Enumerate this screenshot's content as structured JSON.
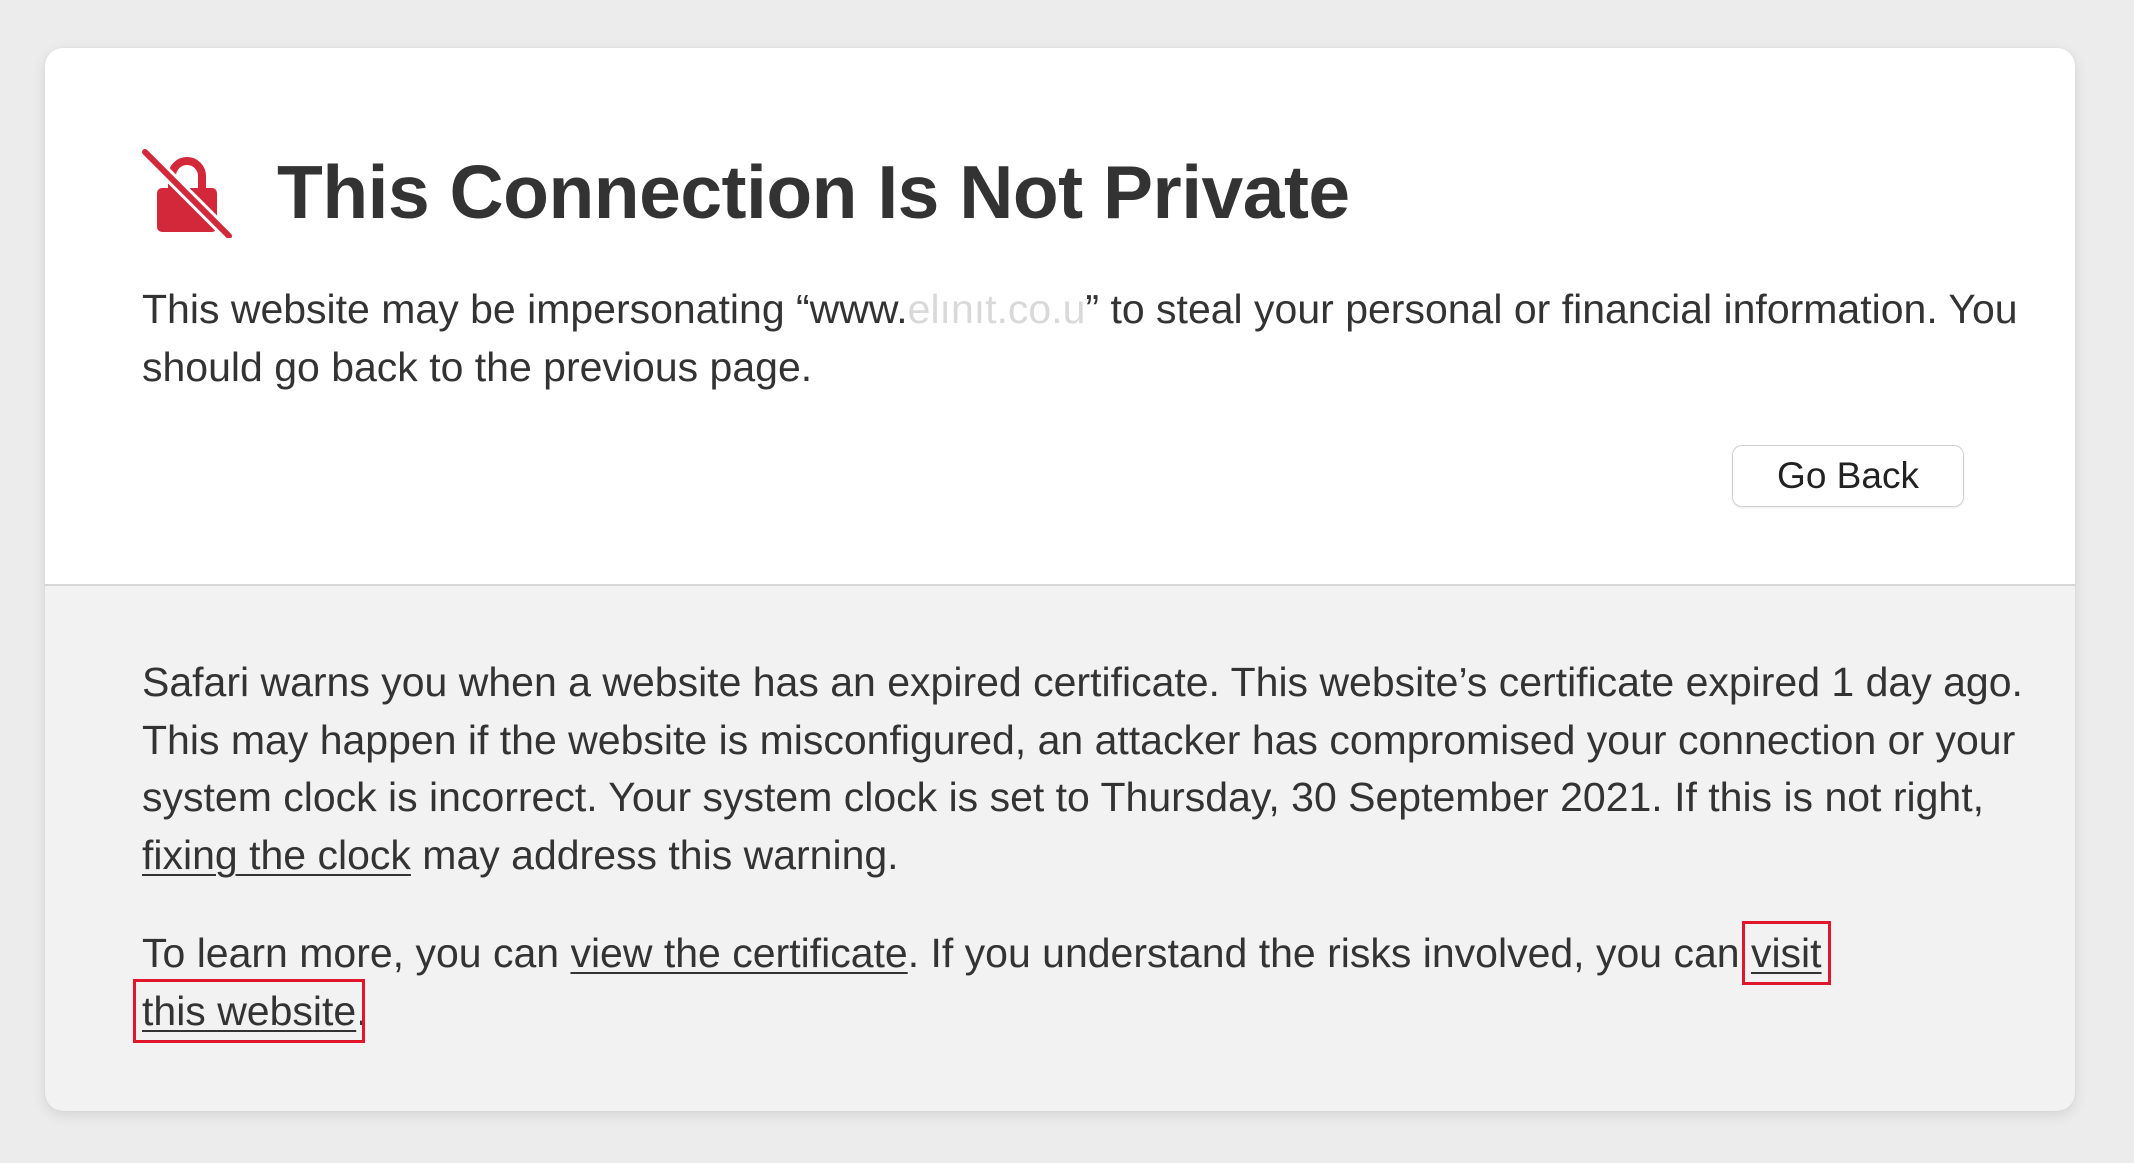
{
  "window": {
    "title": "This Connection Is Not Private"
  },
  "icons": {
    "warning": "broken-lock-icon",
    "warning_color": "#d3283a"
  },
  "warning": {
    "line_start": "This website may be impersonating “www.",
    "domain_obscured": "elınıt.co.u",
    "line_end": "” to steal your personal or financial information. You should go back to the previous page."
  },
  "actions": {
    "go_back_label": "Go Back"
  },
  "details": {
    "paragraph1_text": "Safari warns you when a website has an expired certificate. This website’s certificate expired 1 day ago. This may happen if the website is misconfigured, an attacker has compromised your connection or your system clock is incorrect. Your system clock is set to Thursday, 30 September 2021. If this is not right, ",
    "fix_clock_link": "fixing the clock",
    "paragraph1_end": " may address this warning.",
    "paragraph2_start": "To learn more, you can ",
    "view_certificate_link": "view the certificate",
    "paragraph2_mid": ". If you understand the risks involved, you can ",
    "visit_link_part1": "visit",
    "visit_link_part2": "this website",
    "paragraph2_end": "."
  },
  "colors": {
    "highlight_box": "#e0162b",
    "text": "#333333",
    "card_top": "#ffffff",
    "card_bottom": "#f2f2f2"
  }
}
